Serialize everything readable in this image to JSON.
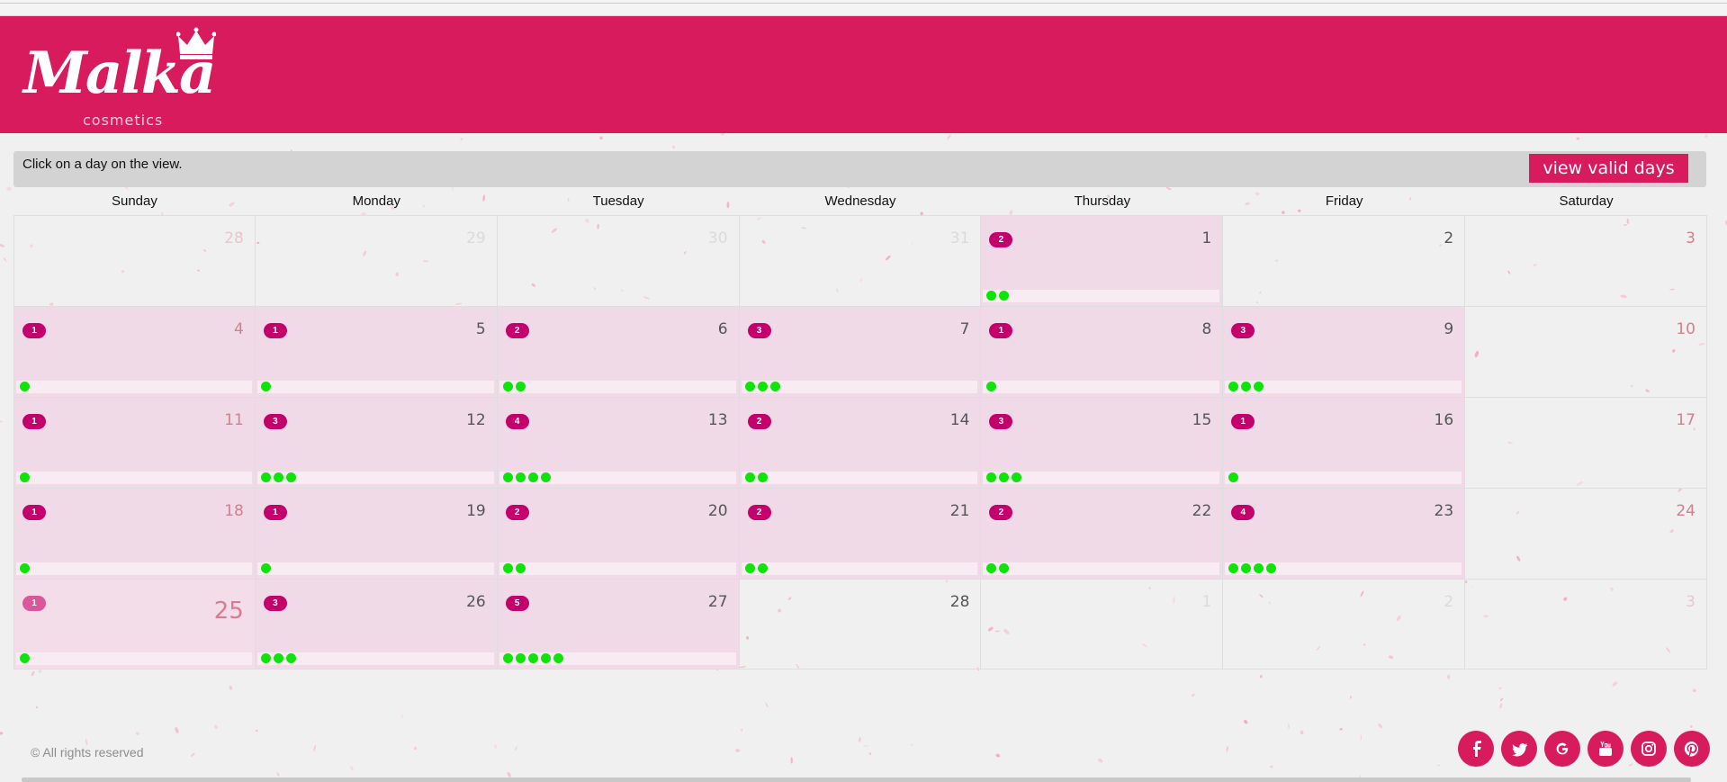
{
  "brand": {
    "name": "Malka",
    "sub": "cosmetics",
    "color": "#d81b5c"
  },
  "infobar": {
    "text": "Click on a day on the view.",
    "button": "view valid days"
  },
  "calendar": {
    "weekdays": [
      "Sunday",
      "Monday",
      "Tuesday",
      "Wednesday",
      "Thursday",
      "Friday",
      "Saturday"
    ],
    "weeks": [
      [
        {
          "day": "28",
          "current": false,
          "count": 0
        },
        {
          "day": "29",
          "current": false,
          "count": 0
        },
        {
          "day": "30",
          "current": false,
          "count": 0
        },
        {
          "day": "31",
          "current": false,
          "count": 0
        },
        {
          "day": "1",
          "current": true,
          "count": 2,
          "badge": "2"
        },
        {
          "day": "2",
          "current": true,
          "count": 0
        },
        {
          "day": "3",
          "current": true,
          "count": 0
        }
      ],
      [
        {
          "day": "4",
          "current": true,
          "count": 1,
          "badge": "1"
        },
        {
          "day": "5",
          "current": true,
          "count": 1,
          "badge": "1"
        },
        {
          "day": "6",
          "current": true,
          "count": 2,
          "badge": "2"
        },
        {
          "day": "7",
          "current": true,
          "count": 3,
          "badge": "3"
        },
        {
          "day": "8",
          "current": true,
          "count": 1,
          "badge": "1"
        },
        {
          "day": "9",
          "current": true,
          "count": 3,
          "badge": "3"
        },
        {
          "day": "10",
          "current": true,
          "count": 0
        }
      ],
      [
        {
          "day": "11",
          "current": true,
          "count": 1,
          "badge": "1"
        },
        {
          "day": "12",
          "current": true,
          "count": 3,
          "badge": "3"
        },
        {
          "day": "13",
          "current": true,
          "count": 4,
          "badge": "4"
        },
        {
          "day": "14",
          "current": true,
          "count": 2,
          "badge": "2"
        },
        {
          "day": "15",
          "current": true,
          "count": 3,
          "badge": "3"
        },
        {
          "day": "16",
          "current": true,
          "count": 1,
          "badge": "1"
        },
        {
          "day": "17",
          "current": true,
          "count": 0
        }
      ],
      [
        {
          "day": "18",
          "current": true,
          "count": 1,
          "badge": "1"
        },
        {
          "day": "19",
          "current": true,
          "count": 1,
          "badge": "1"
        },
        {
          "day": "20",
          "current": true,
          "count": 2,
          "badge": "2"
        },
        {
          "day": "21",
          "current": true,
          "count": 2,
          "badge": "2"
        },
        {
          "day": "22",
          "current": true,
          "count": 2,
          "badge": "2"
        },
        {
          "day": "23",
          "current": true,
          "count": 4,
          "badge": "4"
        },
        {
          "day": "24",
          "current": true,
          "count": 0
        }
      ],
      [
        {
          "day": "25",
          "current": true,
          "today": true,
          "count": 1,
          "badge": "1"
        },
        {
          "day": "26",
          "current": true,
          "count": 3,
          "badge": "3"
        },
        {
          "day": "27",
          "current": true,
          "count": 5,
          "badge": "5"
        },
        {
          "day": "28",
          "current": true,
          "count": 0
        },
        {
          "day": "1",
          "current": false,
          "count": 0
        },
        {
          "day": "2",
          "current": false,
          "count": 0
        },
        {
          "day": "3",
          "current": false,
          "count": 0
        }
      ]
    ]
  },
  "footer": {
    "copyright": "© All rights reserved",
    "socials": [
      "facebook-icon",
      "twitter-icon",
      "google-icon",
      "youtube-icon",
      "instagram-icon",
      "pinterest-icon"
    ]
  }
}
